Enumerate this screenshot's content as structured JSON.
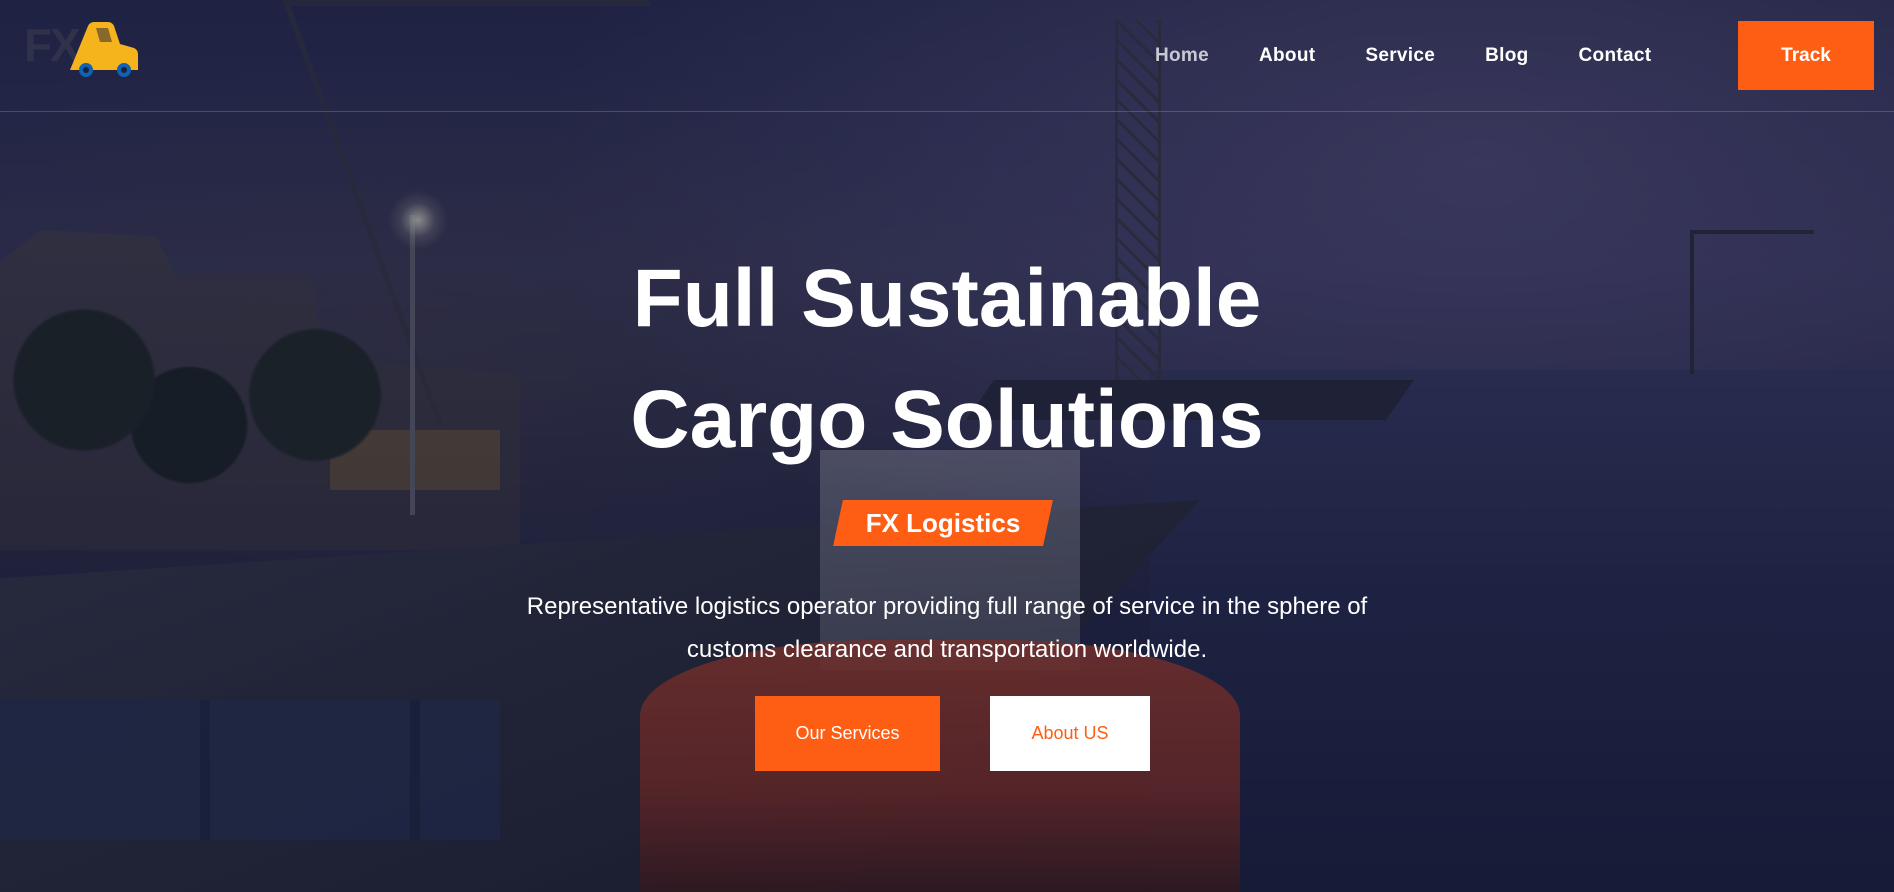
{
  "brand": {
    "logo_letters": "FX",
    "accent_color": "#fd5e14",
    "logo_yellow": "#f5b31c"
  },
  "nav": {
    "items": [
      {
        "label": "Home",
        "active": true
      },
      {
        "label": "About",
        "active": false
      },
      {
        "label": "Service",
        "active": false
      },
      {
        "label": "Blog",
        "active": false
      },
      {
        "label": "Contact",
        "active": false
      }
    ],
    "track_label": "Track"
  },
  "hero": {
    "title_line1": "Full Sustainable",
    "title_line2": "Cargo Solutions",
    "tag": "FX Logistics",
    "subtitle_line1": "Representative logistics operator providing full range of service in the sphere of",
    "subtitle_line2": "customs clearance and transportation worldwide.",
    "primary_button": "Our Services",
    "secondary_button": "About US"
  },
  "icons": {
    "logo": "truck-logo-icon"
  }
}
